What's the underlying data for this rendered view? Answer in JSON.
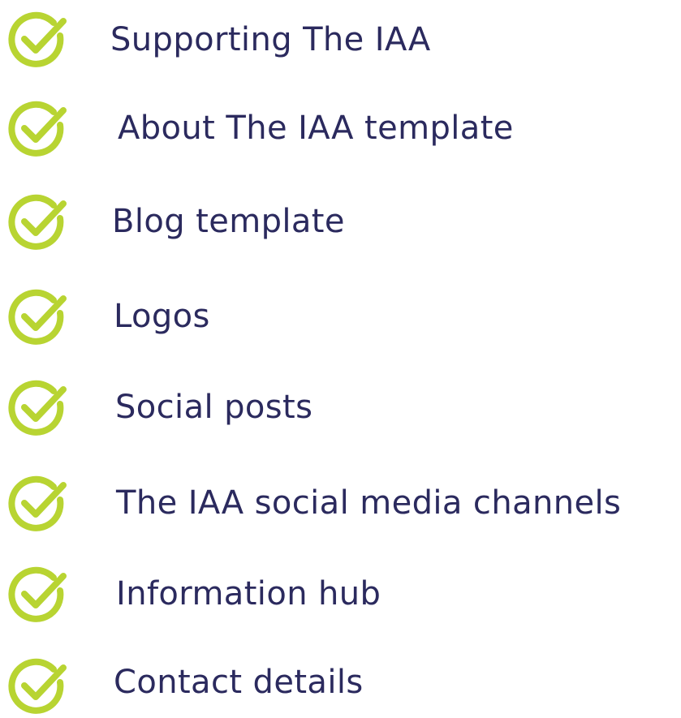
{
  "checklist": {
    "icon": "check-circle-icon",
    "colors": {
      "check": "#b8d432",
      "text": "#2b2a5e"
    },
    "items": [
      {
        "label": "Supporting The IAA"
      },
      {
        "label": "About The IAA template"
      },
      {
        "label": "Blog template"
      },
      {
        "label": "Logos"
      },
      {
        "label": "Social posts"
      },
      {
        "label": "The IAA social media channels"
      },
      {
        "label": "Information hub"
      },
      {
        "label": "Contact details"
      }
    ]
  }
}
